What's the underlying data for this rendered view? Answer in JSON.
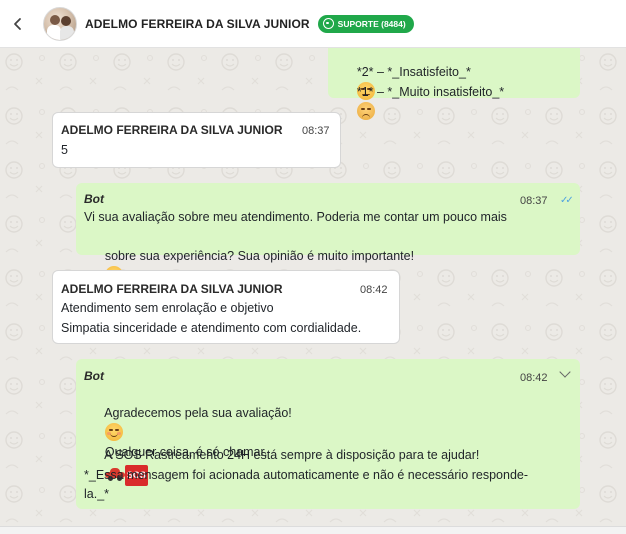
{
  "header": {
    "contact_name": "ADELMO FERREIRA DA SILVA JUNIOR",
    "badge_label": "SUPORTE (8484)",
    "badge_color": "#20a84a",
    "back_icon": "chevron-left-icon",
    "avatar_icon": "avatar"
  },
  "messages": [
    {
      "direction": "outgoing",
      "lines": [
        "*2* – *_Insatisfeito_*",
        "*1* – *_Muito insatisfeito_*"
      ],
      "emojis": [
        "rolling-eyes-emoji",
        "pensive-emoji"
      ]
    },
    {
      "direction": "incoming",
      "sender": "ADELMO FERREIRA DA SILVA JUNIOR",
      "time": "08:37",
      "lines": [
        "5"
      ]
    },
    {
      "direction": "outgoing",
      "sender": "Bot",
      "time": "08:37",
      "status": "read",
      "lines": [
        "Vi sua avaliação sobre meu atendimento. Poderia me contar um pouco mais",
        "sobre sua experiência? Sua opinião é muito importante!"
      ],
      "emojis": [
        "smiling-blush-emoji"
      ]
    },
    {
      "direction": "incoming",
      "sender": "ADELMO FERREIRA DA SILVA JUNIOR",
      "time": "08:42",
      "lines": [
        "Atendimento sem enrolação e objetivo",
        "Simpatia sinceridade e atendimento com cordialidade."
      ]
    },
    {
      "direction": "outgoing",
      "sender": "Bot",
      "time": "08:42",
      "lines": [
        "Agradecemos pela sua avaliação!",
        "Qualquer coisa, é só chamar.",
        "A SOS Rastreamento 24H está sempre à disposição para te ajudar!",
        "*_Essa mensagem foi acionada automaticamente e não é necessário responde-",
        "la._*"
      ],
      "sos_label": "SOS",
      "emojis": [
        "smiling-blush-emoji",
        "car-emoji",
        "sos-emoji"
      ]
    }
  ],
  "colors": {
    "chat_background": "#eceae6",
    "outgoing_bubble": "#dbf7c6",
    "incoming_bubble": "#ffffff",
    "read_ticks": "#4fa3e0"
  }
}
